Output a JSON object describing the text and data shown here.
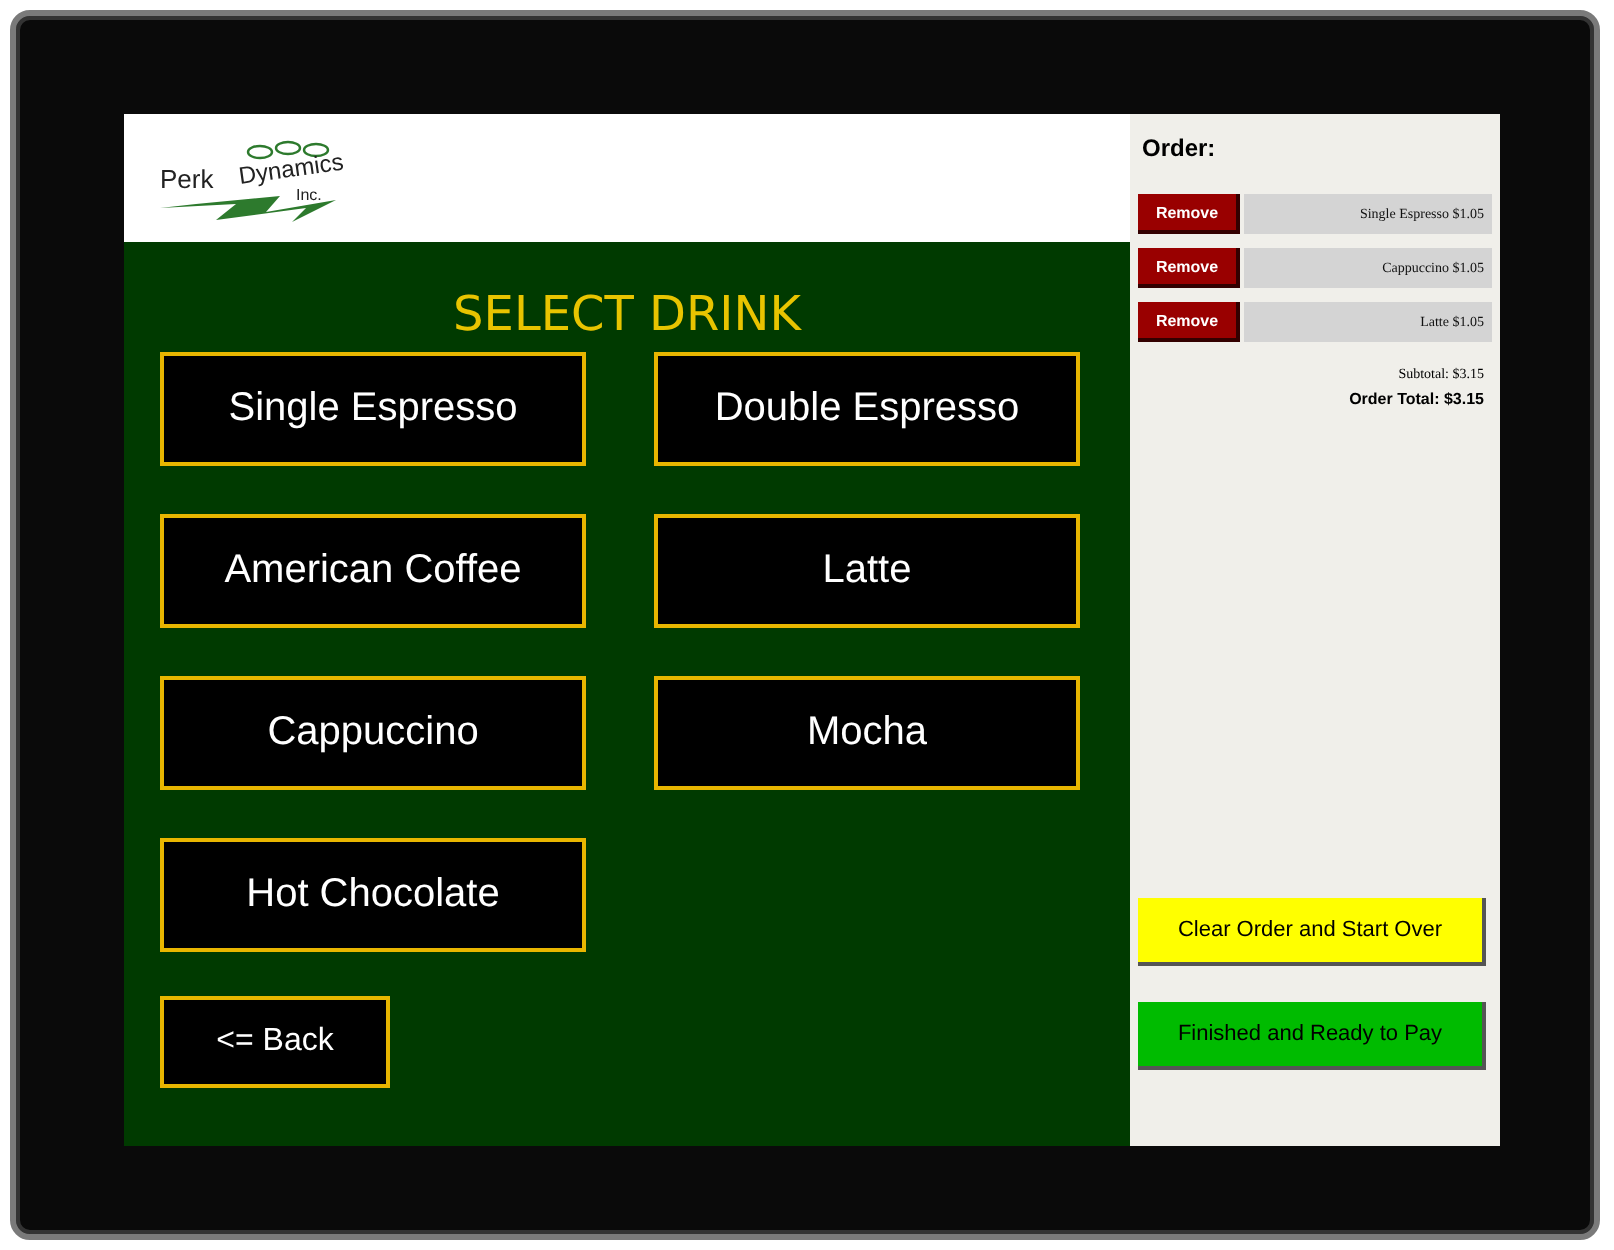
{
  "logo": {
    "words": [
      "Perk",
      "Dynamics",
      "Inc."
    ]
  },
  "heading": "SELECT DRINK",
  "drinks": [
    "Single Espresso",
    "Double Espresso",
    "American Coffee",
    "Latte",
    "Cappuccino",
    "Mocha",
    "Hot Chocolate"
  ],
  "back_button": "<= Back",
  "order": {
    "title": "Order:",
    "items": [
      {
        "remove": "Remove",
        "label": "Single Espresso $1.05"
      },
      {
        "remove": "Remove",
        "label": "Cappuccino $1.05"
      },
      {
        "remove": "Remove",
        "label": "Latte $1.05"
      }
    ],
    "subtotal": "Subtotal: $3.15",
    "total": "Order Total: $3.15"
  },
  "actions": [
    {
      "kind": "clear",
      "label": "Clear Order and Start Over"
    },
    {
      "kind": "finish",
      "label": "Finished and Ready to Pay"
    }
  ]
}
